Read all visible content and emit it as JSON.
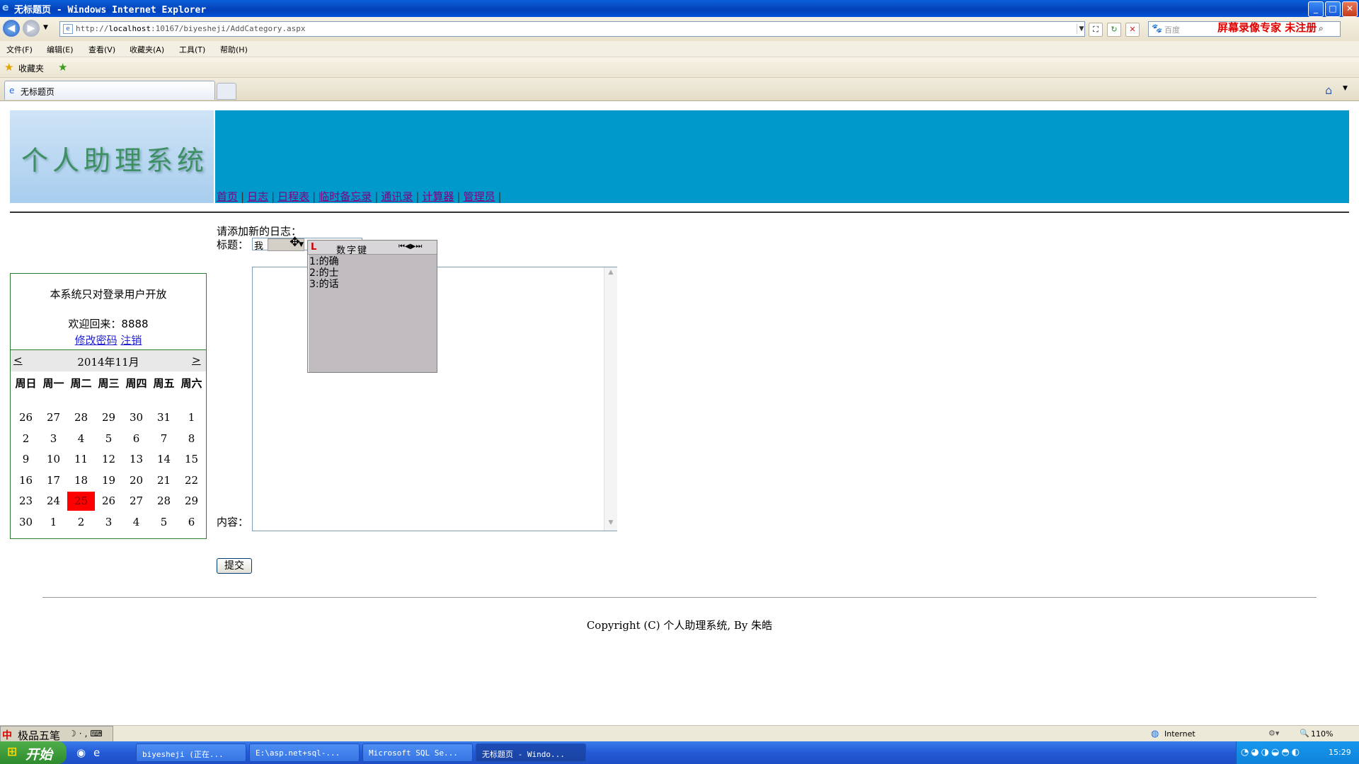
{
  "window": {
    "title": "无标题页 - Windows Internet Explorer",
    "min": "_",
    "max": "□",
    "close": "✕"
  },
  "address": {
    "url_prefix": "http://",
    "url_host": "localhost",
    "url_rest": ":10167/biyesheji/AddCategory.aspx",
    "search_placeholder": "百度",
    "recorder_notice": "屏幕录像专家  未注册"
  },
  "menu": [
    "文件(F)",
    "编辑(E)",
    "查看(V)",
    "收藏夹(A)",
    "工具(T)",
    "帮助(H)"
  ],
  "favorites": {
    "label": "收藏夹"
  },
  "tab": {
    "label": "无标题页"
  },
  "site": {
    "logo": "个人助理系统",
    "nav": [
      "首页",
      "日志",
      "日程表",
      "临时备忘录",
      "通讯录",
      "计算器",
      "管理员"
    ],
    "notice": "本系统只对登录用户开放",
    "welcome": "欢迎回来：8888",
    "change_password": "修改密码",
    "logout": "注销",
    "calendar": {
      "prev": "<",
      "next": ">",
      "title": "2014年11月",
      "weekdays": [
        "周日",
        "周一",
        "周二",
        "周三",
        "周四",
        "周五",
        "周六"
      ],
      "weeks": [
        [
          "26",
          "27",
          "28",
          "29",
          "30",
          "31",
          "1"
        ],
        [
          "2",
          "3",
          "4",
          "5",
          "6",
          "7",
          "8"
        ],
        [
          "9",
          "10",
          "11",
          "12",
          "13",
          "14",
          "15"
        ],
        [
          "16",
          "17",
          "18",
          "19",
          "20",
          "21",
          "22"
        ],
        [
          "23",
          "24",
          "25",
          "26",
          "27",
          "28",
          "29"
        ],
        [
          "30",
          "1",
          "2",
          "3",
          "4",
          "5",
          "6"
        ]
      ],
      "selected_day": "25",
      "selected_color": "#ff0000"
    },
    "form": {
      "heading": "请添加新的日志：",
      "title_label": "标题：",
      "title_value": "我",
      "content_label": "内容：",
      "submit": "提交"
    },
    "copyright": "Copyright (C) 个人助理系统, By 朱皓"
  },
  "ime": {
    "mode": "数字键",
    "nav": "⏮◀▶⏭",
    "candidates": [
      "1:的确",
      "2:的士",
      "3:的话"
    ],
    "bar_name": "极品五笔"
  },
  "status": {
    "zone": "Internet",
    "zoom": "110%"
  },
  "taskbar": {
    "start": "开始",
    "tasks": [
      "biyesheji (正在...",
      "E:\\asp.net+sql-...",
      "Microsoft SQL Se...",
      "无标题页 - Windo..."
    ],
    "clock": "15:29"
  }
}
